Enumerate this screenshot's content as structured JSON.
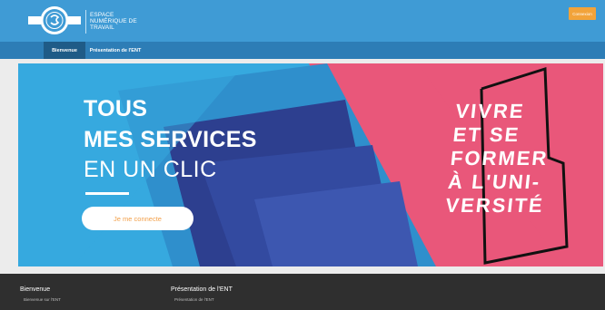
{
  "header": {
    "logo_lines": [
      "ESPACE",
      "NUMÉRIQUE DE",
      "TRAVAIL"
    ],
    "connect_button": "Connexion"
  },
  "nav": {
    "tabs": [
      {
        "label": "Bienvenue",
        "active": true
      },
      {
        "label": "Présentation de l'ENT",
        "active": false
      }
    ]
  },
  "hero": {
    "title_line1": "TOUS",
    "title_line2": "MES SERVICES",
    "title_line3": "EN UN CLIC",
    "login_button": "Je me connecte",
    "slogan_lines": [
      "VIVRE",
      "ET SE",
      "FORMER",
      "À L'UNI-",
      "VERSITÉ"
    ],
    "colors": {
      "blue": "#36a9df",
      "dark_blue": "#2d3f8f",
      "pink": "#e9577a",
      "orange": "#f3a04a"
    }
  },
  "footer": {
    "col1": {
      "heading": "Bienvenue",
      "link": "Bienvenue sur l'ENT"
    },
    "col2": {
      "heading": "Présentation de l'ENT",
      "link": "Présentation de l'ENT"
    }
  }
}
